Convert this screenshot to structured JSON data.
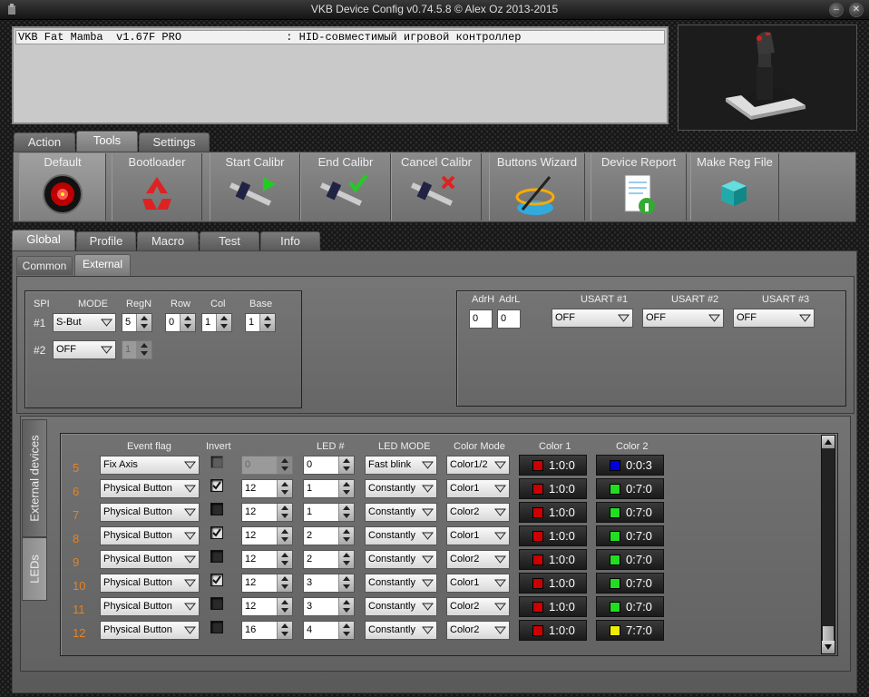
{
  "window": {
    "title": "VKB Device Config v0.74.5.8 © Alex Oz 2013-2015"
  },
  "device": {
    "row": "VKB Fat Mamba  v1.67F PRO                : HID-совместимый игровой контроллер"
  },
  "top_tabs": [
    {
      "label": "Action"
    },
    {
      "label": "Tools"
    },
    {
      "label": "Settings"
    }
  ],
  "tools": [
    {
      "label": "Default"
    },
    {
      "label": "Bootloader"
    },
    {
      "label": "Start Calibr"
    },
    {
      "label": "End Calibr"
    },
    {
      "label": "Cancel Calibr"
    },
    {
      "label": "Buttons Wizard"
    },
    {
      "label": "Device Report"
    },
    {
      "label": "Make Reg File"
    }
  ],
  "main_tabs": [
    {
      "label": "Global"
    },
    {
      "label": "Profile"
    },
    {
      "label": "Macro"
    },
    {
      "label": "Test"
    },
    {
      "label": "Info"
    }
  ],
  "sub_tabs": [
    {
      "label": "Common"
    },
    {
      "label": "External"
    }
  ],
  "spi": {
    "headers": {
      "spi": "SPI",
      "mode": "MODE",
      "regn": "RegN",
      "row": "Row",
      "col": "Col",
      "base": "Base"
    },
    "rows": [
      {
        "label": "#1",
        "mode": "S-But",
        "regn": "5",
        "row": "0",
        "col": "1",
        "base": "1"
      },
      {
        "label": "#2",
        "mode": "OFF",
        "regn": "1"
      }
    ]
  },
  "usart": {
    "headers": {
      "adrh": "AdrH",
      "adrl": "AdrL",
      "u1": "USART #1",
      "u2": "USART #2",
      "u3": "USART #3"
    },
    "adrh": "0",
    "adrl": "0",
    "u1": "OFF",
    "u2": "OFF",
    "u3": "OFF"
  },
  "side_tabs": [
    {
      "label": "External devices"
    },
    {
      "label": "LEDs"
    }
  ],
  "leds": {
    "headers": {
      "event": "Event flag",
      "invert": "Invert",
      "led": "LED #",
      "mode": "LED MODE",
      "cmode": "Color Mode",
      "c1": "Color 1",
      "c2": "Color 2"
    },
    "rows": [
      {
        "n": "5",
        "event": "Fix Axis",
        "invert": false,
        "val": "0",
        "led": "0",
        "mode": "Fast blink",
        "cmode": "Color1/2",
        "c1": "1:0:0",
        "c1hex": "#cc0000",
        "c2": "0:0:3",
        "c2hex": "#0000dd",
        "dis": true
      },
      {
        "n": "6",
        "event": "Physical Button",
        "invert": true,
        "val": "12",
        "led": "1",
        "mode": "Constantly",
        "cmode": "Color1",
        "c1": "1:0:0",
        "c1hex": "#cc0000",
        "c2": "0:7:0",
        "c2hex": "#22dd22"
      },
      {
        "n": "7",
        "event": "Physical Button",
        "invert": false,
        "val": "12",
        "led": "1",
        "mode": "Constantly",
        "cmode": "Color2",
        "c1": "1:0:0",
        "c1hex": "#cc0000",
        "c2": "0:7:0",
        "c2hex": "#22dd22"
      },
      {
        "n": "8",
        "event": "Physical Button",
        "invert": true,
        "val": "12",
        "led": "2",
        "mode": "Constantly",
        "cmode": "Color1",
        "c1": "1:0:0",
        "c1hex": "#cc0000",
        "c2": "0:7:0",
        "c2hex": "#22dd22"
      },
      {
        "n": "9",
        "event": "Physical Button",
        "invert": false,
        "val": "12",
        "led": "2",
        "mode": "Constantly",
        "cmode": "Color2",
        "c1": "1:0:0",
        "c1hex": "#cc0000",
        "c2": "0:7:0",
        "c2hex": "#22dd22"
      },
      {
        "n": "10",
        "event": "Physical Button",
        "invert": true,
        "val": "12",
        "led": "3",
        "mode": "Constantly",
        "cmode": "Color1",
        "c1": "1:0:0",
        "c1hex": "#cc0000",
        "c2": "0:7:0",
        "c2hex": "#22dd22"
      },
      {
        "n": "11",
        "event": "Physical Button",
        "invert": false,
        "val": "12",
        "led": "3",
        "mode": "Constantly",
        "cmode": "Color2",
        "c1": "1:0:0",
        "c1hex": "#cc0000",
        "c2": "0:7:0",
        "c2hex": "#22dd22"
      },
      {
        "n": "12",
        "event": "Physical Button",
        "invert": false,
        "val": "16",
        "led": "4",
        "mode": "Constantly",
        "cmode": "Color2",
        "c1": "1:0:0",
        "c1hex": "#cc0000",
        "c2": "7:7:0",
        "c2hex": "#eeee00"
      }
    ]
  },
  "icons": {
    "window": "app-icon",
    "min": "minimize-icon",
    "close": "close-icon"
  }
}
